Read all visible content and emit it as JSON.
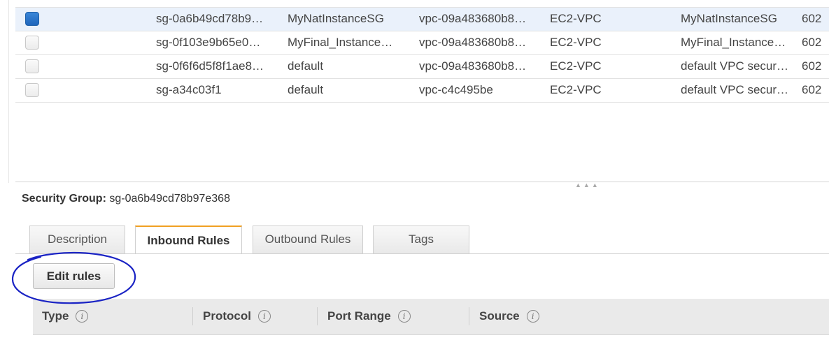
{
  "security_groups": {
    "rows": [
      {
        "id": "sg-0a6b49cd78b9…",
        "name": "MyNatInstanceSG",
        "vpc": "vpc-09a483680b8…",
        "type": "EC2-VPC",
        "description": "MyNatInstanceSG",
        "owner": "602",
        "selected": true
      },
      {
        "id": "sg-0f103e9b65e0…",
        "name": "MyFinal_Instance…",
        "vpc": "vpc-09a483680b8…",
        "type": "EC2-VPC",
        "description": "MyFinal_Instance…",
        "owner": "602",
        "selected": false
      },
      {
        "id": "sg-0f6f6d5f8f1ae8…",
        "name": "default",
        "vpc": "vpc-09a483680b8…",
        "type": "EC2-VPC",
        "description": "default VPC secur…",
        "owner": "602",
        "selected": false
      },
      {
        "id": "sg-a34c03f1",
        "name": "default",
        "vpc": "vpc-c4c495be",
        "type": "EC2-VPC",
        "description": "default VPC secur…",
        "owner": "602",
        "selected": false
      }
    ]
  },
  "detail": {
    "label": "Security Group:",
    "value": "sg-0a6b49cd78b97e368",
    "tabs": [
      {
        "label": "Description",
        "active": false
      },
      {
        "label": "Inbound Rules",
        "active": true
      },
      {
        "label": "Outbound Rules",
        "active": false
      },
      {
        "label": "Tags",
        "active": false
      }
    ],
    "edit_rules_label": "Edit rules",
    "rules_columns": [
      "Type",
      "Protocol",
      "Port Range",
      "Source"
    ],
    "info_glyph": "i"
  },
  "colors": {
    "active_tab_accent": "#f0a022",
    "checkbox_selected": "#2a74c9",
    "annotation_circle": "#1a23c4"
  }
}
